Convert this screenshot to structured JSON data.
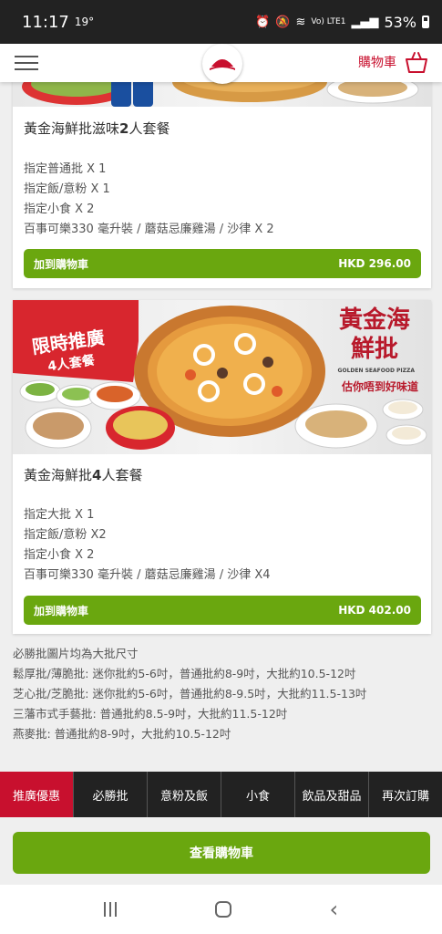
{
  "status_bar": {
    "time": "11:17",
    "temp": "19°",
    "network": "Vo) LTE1",
    "battery": "53%"
  },
  "header": {
    "cart_label": "購物車"
  },
  "cards": [
    {
      "title_pre": "黃金海鮮批滋味",
      "title_bold": "2",
      "title_post": "人套餐",
      "items": [
        "指定普通批 X 1",
        "指定飯/意粉 X 1",
        "指定小食 X 2",
        "百事可樂330 毫升裝 / 蘑菇忌廉雞湯 / 沙律 X 2"
      ],
      "button_label": "加到購物車",
      "price": "HKD 296.00"
    },
    {
      "promo_line1": "限時推廣",
      "promo_line2": "4人套餐",
      "brand_title": "黃金海鮮批",
      "brand_sub": "GOLDEN SEAFOOD PIZZA",
      "brand_tagline": "估你唔到好味道",
      "title_pre": "黃金海鮮批",
      "title_bold": "4",
      "title_post": "人套餐",
      "items": [
        "指定大批 X 1",
        "指定飯/意粉 X2",
        "指定小食 X 2",
        "百事可樂330 毫升裝 / 蘑菇忌廉雞湯 / 沙律 X4"
      ],
      "button_label": "加到購物車",
      "price": "HKD 402.00"
    }
  ],
  "note": [
    "必勝批圖片均為大批尺寸",
    "鬆厚批/薄脆批: 迷你批約5-6吋，普通批約8-9吋，大批約10.5-12吋",
    "芝心批/芝脆批: 迷你批約5-6吋，普通批約8-9.5吋，大批約11.5-13吋",
    "三藩市式手藝批: 普通批約8.5-9吋，大批約11.5-12吋",
    "燕麥批: 普通批約8-9吋，大批約10.5-12吋"
  ],
  "tabs": [
    "推廣優惠",
    "必勝批",
    "意粉及飯",
    "小食",
    "飲品及甜品",
    "再次訂購"
  ],
  "view_cart": "查看購物車",
  "colors": {
    "brand_red": "#c8102e",
    "button_green": "#6aa70f",
    "tab_dark": "#222222"
  }
}
